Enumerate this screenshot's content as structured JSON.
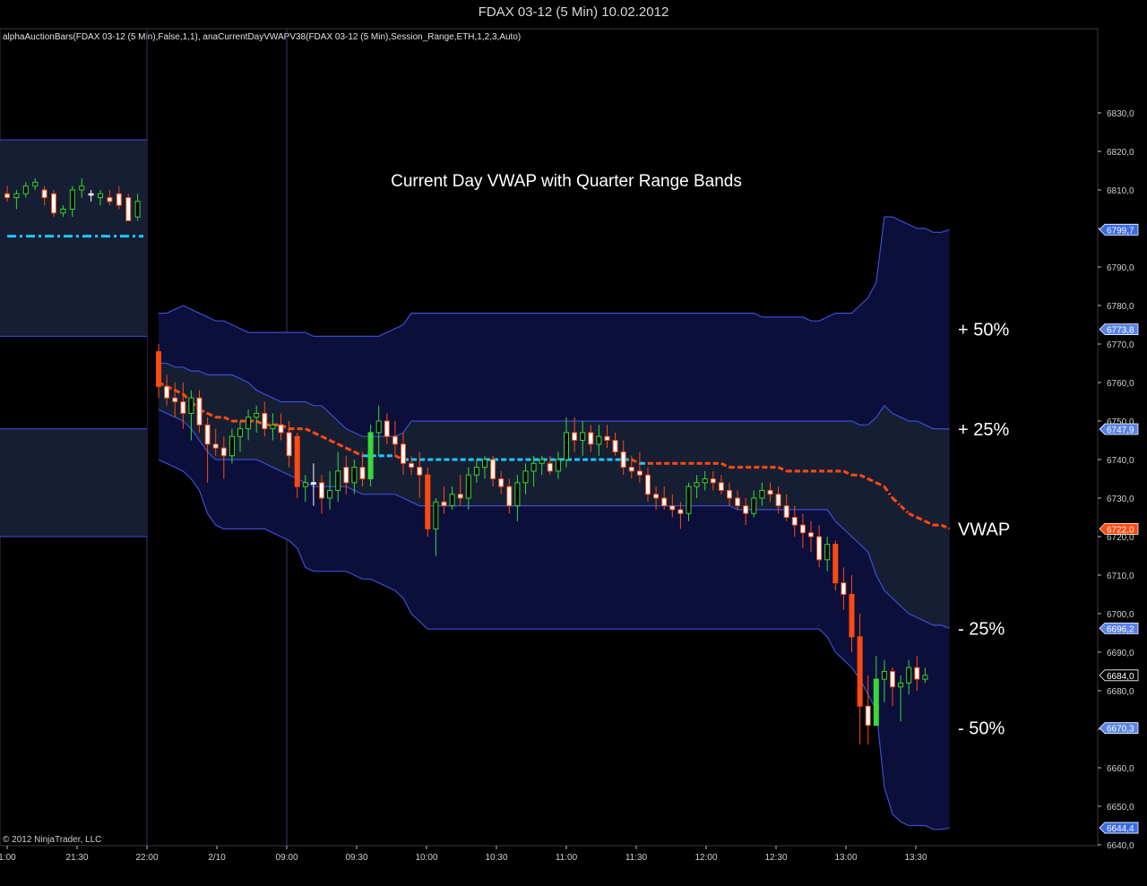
{
  "window": {
    "title": "FDAX 03-12 (5 Min)  10.02.2012"
  },
  "indicator_line": "alphaAuctionBars(FDAX 03-12 (5 Min),False,1,1), anaCurrentDayVWAPV38(FDAX 03-12 (5 Min),Session_Range,ETH,1,2,3,Auto)",
  "copyright": "© 2012 NinjaTrader, LLC",
  "colors": {
    "background": "#000000",
    "band_outer_fill": "#0b0f3a",
    "band_inner_fill": "#161e33",
    "band_line": "#3b4fd0",
    "vwap_current": "#ff4a10",
    "vwap_prior": "#1ec8ff",
    "candle_up": "#38d838",
    "candle_down": "#ff4a10",
    "candle_neutral": "#ffffff",
    "candle_highlight": "#ffe000",
    "grid": "#4a2a6a"
  },
  "chart_data": {
    "type": "candlestick",
    "title": "Current Day VWAP with Quarter Range Bands",
    "ylim": [
      6640,
      6835
    ],
    "y_ticks": [
      "6640,0",
      "6650,0",
      "6660,0",
      "6670,0",
      "6680,0",
      "6690,0",
      "6700,0",
      "6710,0",
      "6720,0",
      "6730,0",
      "6740,0",
      "6750,0",
      "6760,0",
      "6770,0",
      "6780,0",
      "6790,0",
      "6800,0",
      "6810,0",
      "6820,0",
      "6830,0"
    ],
    "x_ticks": [
      "1:00",
      "21:30",
      "22:00",
      "2/10",
      "09:00",
      "09:30",
      "10:00",
      "10:30",
      "11:00",
      "11:30",
      "12:00",
      "12:30",
      "13:00",
      "13:30"
    ],
    "session_separators": [
      "22:00",
      "09:00"
    ],
    "band_labels": [
      {
        "text": "+ 50%",
        "value": 6773.8
      },
      {
        "text": "+ 25%",
        "value": 6747.9
      },
      {
        "text": "VWAP",
        "value": 6722.0
      },
      {
        "text": "- 25%",
        "value": 6696.2
      },
      {
        "text": "- 50%",
        "value": 6670.3
      }
    ],
    "price_markers": [
      {
        "text": "6799,7",
        "value": 6799.7,
        "color": "#3a6ae8"
      },
      {
        "text": "6773,8",
        "value": 6773.8,
        "color": "#5a82e8"
      },
      {
        "text": "6747,9",
        "value": 6747.9,
        "color": "#5a82e8"
      },
      {
        "text": "6722,0",
        "value": 6722.0,
        "color": "#ff4a10"
      },
      {
        "text": "6696,2",
        "value": 6696.2,
        "color": "#5a82e8"
      },
      {
        "text": "6684,0",
        "value": 6684.0,
        "color": "#000000"
      },
      {
        "text": "6670,3",
        "value": 6670.3,
        "color": "#5a82e8"
      },
      {
        "text": "6644,4",
        "value": 6644.4,
        "color": "#3a6ae8"
      }
    ],
    "prior_session": {
      "bands": {
        "upper_outer": 6823,
        "upper_inner": 6772,
        "vwap": 6798,
        "lower_inner": 6748,
        "lower_outer": 6720
      },
      "candles": [
        [
          6809,
          6811,
          6807,
          6808
        ],
        [
          6808,
          6810,
          6805,
          6809
        ],
        [
          6809,
          6812,
          6808,
          6811
        ],
        [
          6811,
          6813,
          6810,
          6812
        ],
        [
          6810,
          6811,
          6806,
          6808
        ],
        [
          6809,
          6810,
          6803,
          6804
        ],
        [
          6804,
          6806,
          6803,
          6805
        ],
        [
          6805,
          6811,
          6803,
          6810
        ],
        [
          6810,
          6813,
          6808,
          6811
        ],
        [
          6809,
          6810,
          6807,
          6809
        ],
        [
          6808,
          6810,
          6806,
          6809
        ],
        [
          6808,
          6810,
          6806,
          6807
        ],
        [
          6809,
          6811,
          6805,
          6806
        ],
        [
          6808,
          6809,
          6802,
          6802
        ],
        [
          6803,
          6809,
          6802,
          6807
        ]
      ]
    },
    "bands": {
      "upper_outer": [
        6778,
        6778,
        6779,
        6780,
        6779,
        6778,
        6777,
        6776,
        6776,
        6775,
        6774,
        6773,
        6773,
        6773,
        6773,
        6773,
        6773,
        6773,
        6773,
        6772,
        6772,
        6772,
        6772,
        6772,
        6772,
        6772,
        6772,
        6772,
        6773,
        6774,
        6775,
        6778,
        6778,
        6778,
        6778,
        6778,
        6778,
        6778,
        6778,
        6778,
        6778,
        6778,
        6778,
        6778,
        6778,
        6778,
        6778,
        6778,
        6778,
        6778,
        6778,
        6778,
        6778,
        6778,
        6778,
        6778,
        6778,
        6778,
        6778,
        6778,
        6778,
        6778,
        6778,
        6778,
        6778,
        6778,
        6778,
        6778,
        6778,
        6778,
        6778,
        6778,
        6778,
        6778,
        6777,
        6777,
        6777,
        6777,
        6777,
        6777,
        6776,
        6776,
        6777,
        6778,
        6778,
        6778,
        6780,
        6782,
        6786,
        6803,
        6803,
        6802,
        6801,
        6800,
        6800,
        6799,
        6799,
        6799.7
      ],
      "upper_inner": [
        6765,
        6765,
        6764,
        6764,
        6763,
        6763,
        6762,
        6762,
        6762,
        6762,
        6761,
        6760,
        6758,
        6757,
        6756,
        6755,
        6755,
        6755,
        6755,
        6754,
        6754,
        6752,
        6750,
        6748,
        6747,
        6746,
        6746,
        6746,
        6746,
        6746,
        6747,
        6750,
        6750,
        6750,
        6750,
        6750,
        6750,
        6750,
        6750,
        6750,
        6750,
        6750,
        6750,
        6750,
        6750,
        6750,
        6750,
        6750,
        6750,
        6750,
        6750,
        6750,
        6750,
        6750,
        6750,
        6750,
        6750,
        6750,
        6750,
        6750,
        6750,
        6750,
        6750,
        6750,
        6750,
        6750,
        6750,
        6750,
        6750,
        6750,
        6750,
        6750,
        6750,
        6750,
        6750,
        6750,
        6750,
        6750,
        6750,
        6750,
        6750,
        6750,
        6750,
        6750,
        6750,
        6750,
        6749,
        6749,
        6751,
        6754,
        6752,
        6751,
        6750,
        6750,
        6749,
        6748,
        6748,
        6747.9
      ],
      "vwap": [
        6760,
        6759,
        6758,
        6757,
        6755,
        6753,
        6752,
        6751,
        6751,
        6750,
        6750,
        6750,
        6750,
        6749,
        6749,
        6749,
        6748,
        6748,
        6748,
        6747,
        6746,
        6745,
        6744,
        6743,
        6742,
        6741,
        6741,
        6741,
        6741,
        6741,
        6740,
        6740,
        6740,
        6740,
        6740,
        6740,
        6740,
        6740,
        6740,
        6740,
        6740,
        6740,
        6740,
        6740,
        6740,
        6740,
        6740,
        6740,
        6740,
        6740,
        6740,
        6740,
        6740,
        6740,
        6740,
        6740,
        6740,
        6740,
        6740,
        6739,
        6739,
        6739,
        6739,
        6739,
        6739,
        6739,
        6739,
        6739,
        6739,
        6739,
        6738,
        6738,
        6738,
        6738,
        6738,
        6738,
        6738,
        6737,
        6737,
        6737,
        6737,
        6737,
        6737,
        6737,
        6737,
        6736,
        6736,
        6735,
        6734,
        6733,
        6730,
        6728,
        6726,
        6725,
        6724,
        6723,
        6723,
        6722.0
      ],
      "lower_inner": [
        6753,
        6752,
        6751,
        6750,
        6748,
        6745,
        6742,
        6740,
        6740,
        6740,
        6740,
        6740,
        6740,
        6739,
        6738,
        6737,
        6736,
        6735,
        6734,
        6733,
        6733,
        6733,
        6733,
        6733,
        6732,
        6731,
        6731,
        6731,
        6731,
        6731,
        6730,
        6729,
        6728,
        6728,
        6728,
        6728,
        6728,
        6728,
        6728,
        6728,
        6728,
        6728,
        6728,
        6728,
        6728,
        6728,
        6728,
        6728,
        6728,
        6728,
        6728,
        6728,
        6728,
        6728,
        6728,
        6728,
        6728,
        6728,
        6728,
        6728,
        6728,
        6728,
        6728,
        6728,
        6728,
        6728,
        6728,
        6728,
        6728,
        6728,
        6728,
        6727,
        6727,
        6727,
        6727,
        6727,
        6727,
        6727,
        6727,
        6727,
        6727,
        6727,
        6727,
        6724,
        6722,
        6720,
        6718,
        6716,
        6710,
        6706,
        6704,
        6702,
        6700,
        6699,
        6698,
        6697,
        6697,
        6696.2
      ],
      "lower_outer": [
        6740,
        6739,
        6738,
        6737,
        6735,
        6732,
        6726,
        6723,
        6722,
        6722,
        6722,
        6722,
        6722,
        6722,
        6721,
        6720,
        6719,
        6717,
        6712,
        6711,
        6711,
        6711,
        6711,
        6711,
        6710,
        6709,
        6709,
        6708,
        6707,
        6706,
        6704,
        6700,
        6698,
        6696,
        6696,
        6696,
        6696,
        6696,
        6696,
        6696,
        6696,
        6696,
        6696,
        6696,
        6696,
        6696,
        6696,
        6696,
        6696,
        6696,
        6696,
        6696,
        6696,
        6696,
        6696,
        6696,
        6696,
        6696,
        6696,
        6696,
        6696,
        6696,
        6696,
        6696,
        6696,
        6696,
        6696,
        6696,
        6696,
        6696,
        6696,
        6696,
        6696,
        6696,
        6696,
        6696,
        6696,
        6696,
        6696,
        6696,
        6696,
        6696,
        6694,
        6690,
        6688,
        6686,
        6683,
        6679,
        6675,
        6655,
        6648,
        6646,
        6645,
        6645,
        6645,
        6644,
        6644,
        6644.4
      ]
    },
    "candles": [
      [
        6768,
        6770,
        6756,
        6759
      ],
      [
        6759,
        6762,
        6754,
        6756
      ],
      [
        6756,
        6760,
        6751,
        6755
      ],
      [
        6755,
        6760,
        6748,
        6752
      ],
      [
        6752,
        6758,
        6745,
        6756
      ],
      [
        6756,
        6758,
        6747,
        6749
      ],
      [
        6749,
        6751,
        6734,
        6744
      ],
      [
        6744,
        6748,
        6741,
        6743
      ],
      [
        6743,
        6746,
        6735,
        6741
      ],
      [
        6741,
        6748,
        6739,
        6746
      ],
      [
        6746,
        6750,
        6742,
        6748
      ],
      [
        6748,
        6753,
        6745,
        6751
      ],
      [
        6751,
        6754,
        6747,
        6752
      ],
      [
        6752,
        6755,
        6746,
        6748
      ],
      [
        6748,
        6752,
        6745,
        6749
      ],
      [
        6749,
        6752,
        6745,
        6747
      ],
      [
        6747,
        6750,
        6738,
        6741
      ],
      [
        6746,
        6747,
        6730,
        6733
      ],
      [
        6733,
        6736,
        6729,
        6734
      ],
      [
        6734,
        6739,
        6728,
        6734
      ],
      [
        6734,
        6736,
        6726,
        6730
      ],
      [
        6730,
        6737,
        6727,
        6732
      ],
      [
        6732,
        6742,
        6729,
        6737
      ],
      [
        6738,
        6741,
        6731,
        6734
      ],
      [
        6734,
        6740,
        6731,
        6738
      ],
      [
        6738,
        6742,
        6733,
        6735
      ],
      [
        6735,
        6749,
        6733,
        6747
      ],
      [
        6747,
        6754,
        6741,
        6750
      ],
      [
        6750,
        6752,
        6744,
        6746
      ],
      [
        6746,
        6750,
        6741,
        6744
      ],
      [
        6744,
        6747,
        6736,
        6739
      ],
      [
        6739,
        6741,
        6736,
        6738
      ],
      [
        6738,
        6742,
        6730,
        6736
      ],
      [
        6736,
        6738,
        6720,
        6722
      ],
      [
        6722,
        6730,
        6715,
        6729
      ],
      [
        6729,
        6733,
        6726,
        6728
      ],
      [
        6728,
        6733,
        6727,
        6731
      ],
      [
        6731,
        6736,
        6728,
        6730
      ],
      [
        6730,
        6738,
        6727,
        6736
      ],
      [
        6736,
        6740,
        6734,
        6738
      ],
      [
        6738,
        6741,
        6735,
        6740
      ],
      [
        6740,
        6741,
        6733,
        6735
      ],
      [
        6735,
        6737,
        6731,
        6733
      ],
      [
        6733,
        6735,
        6726,
        6728
      ],
      [
        6728,
        6736,
        6724,
        6734
      ],
      [
        6734,
        6739,
        6731,
        6737
      ],
      [
        6737,
        6741,
        6733,
        6739
      ],
      [
        6739,
        6741,
        6736,
        6740
      ],
      [
        6739,
        6741,
        6736,
        6737
      ],
      [
        6737,
        6742,
        6735,
        6740
      ],
      [
        6740,
        6751,
        6738,
        6747
      ],
      [
        6747,
        6751,
        6742,
        6745
      ],
      [
        6745,
        6750,
        6741,
        6747
      ],
      [
        6747,
        6749,
        6742,
        6744
      ],
      [
        6744,
        6749,
        6741,
        6746
      ],
      [
        6746,
        6749,
        6743,
        6745
      ],
      [
        6745,
        6747,
        6741,
        6742
      ],
      [
        6742,
        6745,
        6736,
        6738
      ],
      [
        6738,
        6741,
        6735,
        6737
      ],
      [
        6737,
        6742,
        6734,
        6736
      ],
      [
        6736,
        6738,
        6729,
        6731
      ],
      [
        6731,
        6733,
        6727,
        6730
      ],
      [
        6730,
        6733,
        6727,
        6728
      ],
      [
        6728,
        6731,
        6725,
        6727
      ],
      [
        6727,
        6729,
        6722,
        6726
      ],
      [
        6726,
        6734,
        6724,
        6733
      ],
      [
        6733,
        6736,
        6730,
        6734
      ],
      [
        6734,
        6737,
        6732,
        6735
      ],
      [
        6735,
        6737,
        6732,
        6734
      ],
      [
        6734,
        6736,
        6731,
        6732
      ],
      [
        6732,
        6734,
        6728,
        6730
      ],
      [
        6730,
        6732,
        6727,
        6728
      ],
      [
        6728,
        6730,
        6723,
        6726
      ],
      [
        6726,
        6732,
        6725,
        6730
      ],
      [
        6730,
        6734,
        6728,
        6732
      ],
      [
        6732,
        6734,
        6729,
        6731
      ],
      [
        6731,
        6733,
        6726,
        6728
      ],
      [
        6728,
        6731,
        6724,
        6725
      ],
      [
        6725,
        6728,
        6720,
        6723
      ],
      [
        6723,
        6726,
        6717,
        6721
      ],
      [
        6721,
        6724,
        6716,
        6720
      ],
      [
        6720,
        6723,
        6712,
        6714
      ],
      [
        6714,
        6720,
        6711,
        6718
      ],
      [
        6718,
        6719,
        6706,
        6708
      ],
      [
        6708,
        6712,
        6701,
        6705
      ],
      [
        6705,
        6710,
        6690,
        6694
      ],
      [
        6694,
        6700,
        6666,
        6676
      ],
      [
        6676,
        6684,
        6666,
        6671
      ],
      [
        6671,
        6689,
        6671,
        6683
      ],
      [
        6683,
        6688,
        6677,
        6685
      ],
      [
        6685,
        6686,
        6676,
        6681
      ],
      [
        6681,
        6684,
        6672,
        6682
      ],
      [
        6682,
        6688,
        6679,
        6686
      ],
      [
        6686,
        6689,
        6680,
        6683
      ],
      [
        6683,
        6686,
        6682,
        6684
      ]
    ]
  }
}
